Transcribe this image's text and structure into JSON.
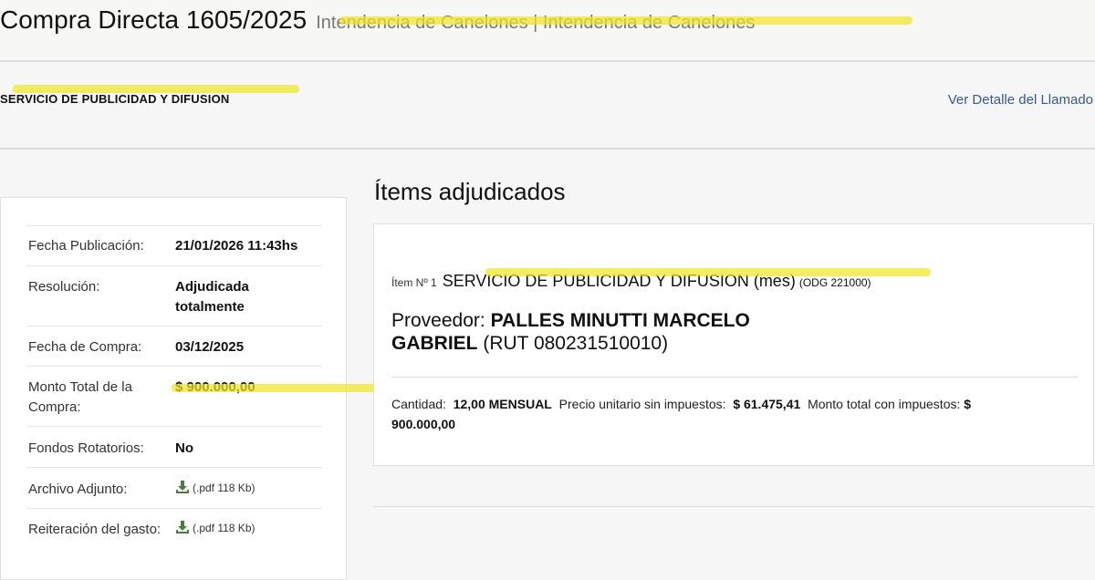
{
  "header": {
    "title": "Compra Directa 1605/2025",
    "subtitle": "Intendencia de Canelones | Intendencia de Canelones"
  },
  "call": {
    "name": "SERVICIO DE PUBLICIDAD Y DIFUSION",
    "detail_link": "Ver Detalle del Llamado"
  },
  "summary": {
    "rows": [
      {
        "label": "Fecha Publicación:",
        "value": "21/01/2026 11:43hs"
      },
      {
        "label": "Resolución:",
        "value": "Adjudicada totalmente"
      },
      {
        "label": "Fecha de Compra:",
        "value": "03/12/2025"
      },
      {
        "label": "Monto Total de la Compra:",
        "value": "$ 900.000,00"
      },
      {
        "label": "Fondos Rotatorios:",
        "value": "No"
      },
      {
        "label": "Archivo Adjunto:",
        "file": "(.pdf 118 Kb)"
      },
      {
        "label": "Reiteración del gasto:",
        "file": "(.pdf 118 Kb)"
      }
    ]
  },
  "items": {
    "title": "Ítems adjudicados",
    "item": {
      "number_label": "Ítem Nº 1",
      "description": "SERVICIO DE PUBLICIDAD Y DIFUSION (mes)",
      "code": "(ODG 221000)",
      "provider_label": "Proveedor:",
      "provider_name": "PALLES MINUTTI MARCELO GABRIEL",
      "provider_rut": "(RUT 080231510010)",
      "quantity_label": "Cantidad:",
      "quantity": "12,00 MENSUAL",
      "unit_price_label": "Precio unitario sin impuestos:",
      "unit_price": "$ 61.475,41",
      "total_label": "Monto total con impuestos:",
      "total": "$ 900.000,00"
    }
  },
  "colors": {
    "highlight": "#f0e628",
    "link": "#3a5a8c",
    "download_icon": "#4a7d3c"
  }
}
